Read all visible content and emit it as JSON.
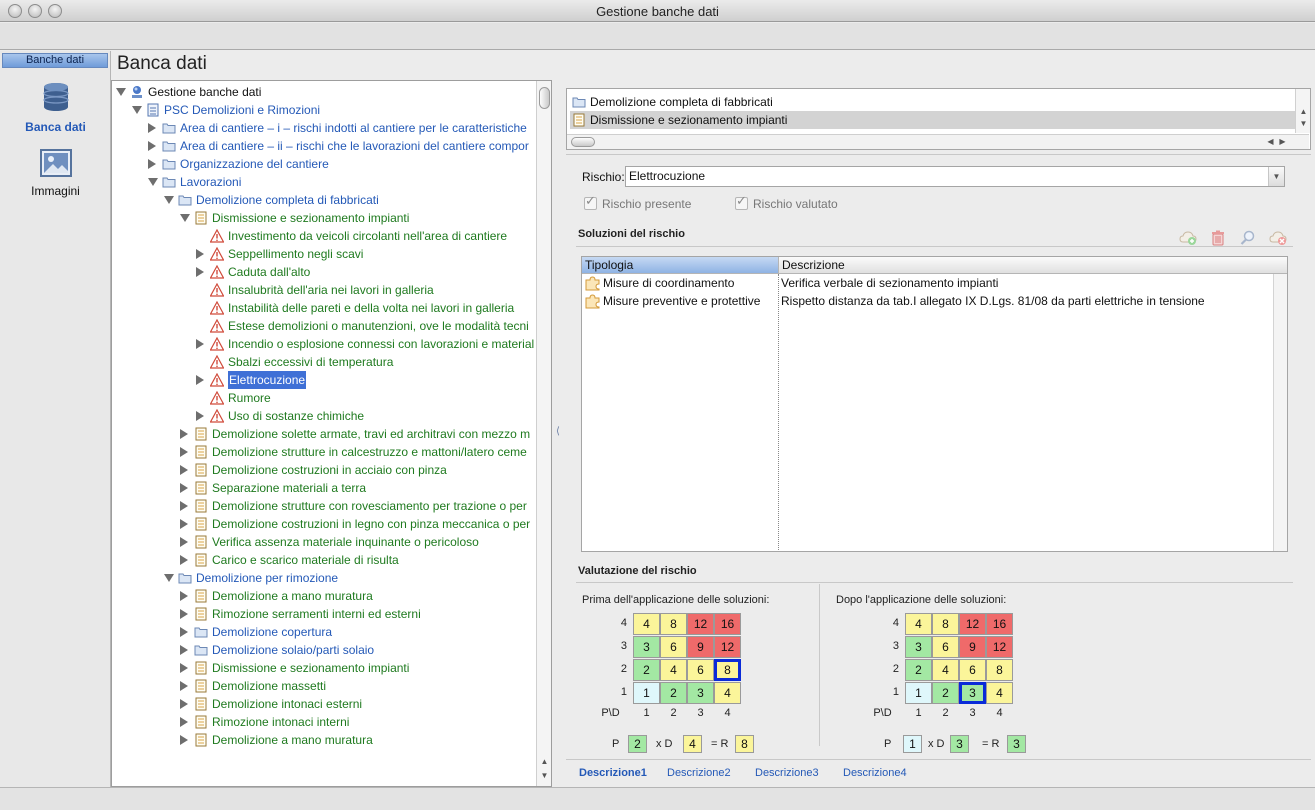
{
  "window": {
    "title": "Gestione banche dati"
  },
  "nav": {
    "header": "Banche dati",
    "items": [
      {
        "label": "Banca dati",
        "active": true,
        "icon": "database-icon"
      },
      {
        "label": "Immagini",
        "active": false,
        "icon": "image-icon"
      }
    ]
  },
  "page": {
    "title": "Banca dati"
  },
  "tree": {
    "rows": [
      {
        "label": "Gestione banche dati",
        "level": 0,
        "toggle": "open",
        "icon": "globe-icon",
        "color": "black"
      },
      {
        "label": "PSC Demolizioni e Rimozioni",
        "level": 1,
        "toggle": "open",
        "icon": "document-blue-icon",
        "color": "blue"
      },
      {
        "label": "Area di cantiere – i – rischi indotti al cantiere per le caratteristiche",
        "level": 2,
        "toggle": "closed",
        "icon": "folder-icon",
        "color": "blue"
      },
      {
        "label": "Area di cantiere – ii – rischi che le lavorazioni del cantiere compor",
        "level": 2,
        "toggle": "closed",
        "icon": "folder-icon",
        "color": "blue"
      },
      {
        "label": "Organizzazione del cantiere",
        "level": 2,
        "toggle": "closed",
        "icon": "folder-icon",
        "color": "blue"
      },
      {
        "label": "Lavorazioni",
        "level": 2,
        "toggle": "open",
        "icon": "folder-icon",
        "color": "blue"
      },
      {
        "label": "Demolizione completa di fabbricati",
        "level": 3,
        "toggle": "open",
        "icon": "folder-icon",
        "color": "blue"
      },
      {
        "label": "Dismissione e sezionamento impianti",
        "level": 4,
        "toggle": "open",
        "icon": "notepad-icon",
        "color": "green"
      },
      {
        "label": "Investimento da veicoli circolanti nell'area di cantiere",
        "level": 5,
        "toggle": "none",
        "icon": "warning-icon",
        "color": "green"
      },
      {
        "label": "Seppellimento negli scavi",
        "level": 5,
        "toggle": "closed",
        "icon": "warning-icon",
        "color": "green"
      },
      {
        "label": "Caduta dall'alto",
        "level": 5,
        "toggle": "closed",
        "icon": "warning-icon",
        "color": "green"
      },
      {
        "label": "Insalubrità dell'aria nei lavori in galleria",
        "level": 5,
        "toggle": "none",
        "icon": "warning-icon",
        "color": "green"
      },
      {
        "label": "Instabilità delle pareti e della volta nei lavori in galleria",
        "level": 5,
        "toggle": "none",
        "icon": "warning-icon",
        "color": "green"
      },
      {
        "label": "Estese demolizioni o manutenzioni, ove le modalità tecni",
        "level": 5,
        "toggle": "none",
        "icon": "warning-icon",
        "color": "green"
      },
      {
        "label": "Incendio o esplosione connessi con lavorazioni e material",
        "level": 5,
        "toggle": "closed",
        "icon": "warning-icon",
        "color": "green"
      },
      {
        "label": "Sbalzi eccessivi di temperatura",
        "level": 5,
        "toggle": "none",
        "icon": "warning-icon",
        "color": "green"
      },
      {
        "label": "Elettrocuzione",
        "level": 5,
        "toggle": "closed",
        "icon": "warning-icon",
        "color": "green",
        "selected": true
      },
      {
        "label": "Rumore",
        "level": 5,
        "toggle": "none",
        "icon": "warning-icon",
        "color": "green"
      },
      {
        "label": "Uso di sostanze chimiche",
        "level": 5,
        "toggle": "closed",
        "icon": "warning-icon",
        "color": "green"
      },
      {
        "label": "Demolizione solette armate, travi ed architravi con mezzo m",
        "level": 4,
        "toggle": "closed",
        "icon": "notepad-icon",
        "color": "green"
      },
      {
        "label": "Demolizione strutture in calcestruzzo e mattoni/latero ceme",
        "level": 4,
        "toggle": "closed",
        "icon": "notepad-icon",
        "color": "green"
      },
      {
        "label": "Demolizione costruzioni in acciaio con pinza",
        "level": 4,
        "toggle": "closed",
        "icon": "notepad-icon",
        "color": "green"
      },
      {
        "label": "Separazione materiali a terra",
        "level": 4,
        "toggle": "closed",
        "icon": "notepad-icon",
        "color": "green"
      },
      {
        "label": "Demolizione strutture con rovesciamento per trazione o per",
        "level": 4,
        "toggle": "closed",
        "icon": "notepad-icon",
        "color": "green"
      },
      {
        "label": "Demolizione costruzioni in legno con pinza meccanica o per",
        "level": 4,
        "toggle": "closed",
        "icon": "notepad-icon",
        "color": "green"
      },
      {
        "label": "Verifica assenza materiale inquinante o pericoloso",
        "level": 4,
        "toggle": "closed",
        "icon": "notepad-icon",
        "color": "green"
      },
      {
        "label": "Carico e scarico materiale di risulta",
        "level": 4,
        "toggle": "closed",
        "icon": "notepad-icon",
        "color": "green"
      },
      {
        "label": "Demolizione per rimozione",
        "level": 3,
        "toggle": "open",
        "icon": "folder-icon",
        "color": "blue"
      },
      {
        "label": "Demolizione a mano muratura",
        "level": 4,
        "toggle": "closed",
        "icon": "notepad-icon",
        "color": "green"
      },
      {
        "label": "Rimozione serramenti interni ed esterni",
        "level": 4,
        "toggle": "closed",
        "icon": "notepad-icon",
        "color": "green"
      },
      {
        "label": "Demolizione copertura",
        "level": 4,
        "toggle": "closed",
        "icon": "folder-icon",
        "color": "blue"
      },
      {
        "label": "Demolizione solaio/parti solaio",
        "level": 4,
        "toggle": "closed",
        "icon": "folder-icon",
        "color": "blue"
      },
      {
        "label": "Dismissione e sezionamento impianti",
        "level": 4,
        "toggle": "closed",
        "icon": "notepad-icon",
        "color": "green"
      },
      {
        "label": "Demolizione massetti",
        "level": 4,
        "toggle": "closed",
        "icon": "notepad-icon",
        "color": "green"
      },
      {
        "label": "Demolizione intonaci esterni",
        "level": 4,
        "toggle": "closed",
        "icon": "notepad-icon",
        "color": "green"
      },
      {
        "label": "Rimozione intonaci interni",
        "level": 4,
        "toggle": "closed",
        "icon": "notepad-icon",
        "color": "green"
      },
      {
        "label": "Demolizione a mano muratura",
        "level": 4,
        "toggle": "closed",
        "icon": "notepad-icon",
        "color": "green"
      }
    ]
  },
  "breadcrumb_list": {
    "rows": [
      {
        "label": "Demolizione completa di fabbricati",
        "icon": "folder-icon",
        "selected": false
      },
      {
        "label": "Dismissione e sezionamento impianti",
        "icon": "notepad-icon",
        "selected": true
      }
    ]
  },
  "rischio": {
    "label": "Rischio:",
    "value": "Elettrocuzione",
    "presente_label": "Rischio presente",
    "valutato_label": "Rischio valutato"
  },
  "soluzioni": {
    "title": "Soluzioni del rischio",
    "columns": [
      "Tipologia",
      "Descrizione"
    ],
    "rows": [
      {
        "tipologia": "Misure di coordinamento",
        "descrizione": "Verifica verbale di sezionamento impianti"
      },
      {
        "tipologia": "Misure preventive e protettive",
        "descrizione": "Rispetto distanza da tab.I allegato IX D.Lgs. 81/08 da parti elettriche in tensione"
      }
    ]
  },
  "valutazione": {
    "title": "Valutazione del rischio",
    "axis_corner": "P\\D",
    "axis_labels": [
      "1",
      "2",
      "3",
      "4"
    ],
    "matrix": [
      [
        1,
        2,
        3,
        4
      ],
      [
        2,
        4,
        6,
        8
      ],
      [
        3,
        6,
        9,
        12
      ],
      [
        4,
        8,
        12,
        16
      ]
    ],
    "colors": {
      "cyan": "#dff7fb",
      "green": "#a3e8a3",
      "yellow": "#fbf59a",
      "red": "#ef6a6a"
    },
    "prima": {
      "title": "Prima dell'applicazione delle soluzioni:",
      "highlight": {
        "p": 2,
        "d": 4
      },
      "p_label": "P",
      "p_value": "2",
      "d_label": "x D",
      "d_value": "4",
      "r_label": "= R",
      "r_value": "8"
    },
    "dopo": {
      "title": "Dopo l'applicazione delle soluzioni:",
      "highlight": {
        "p": 1,
        "d": 3
      },
      "p_label": "P",
      "p_value": "1",
      "d_label": "x D",
      "d_value": "3",
      "r_label": "= R",
      "r_value": "3"
    }
  },
  "tabs": [
    {
      "label": "Descrizione1",
      "active": true
    },
    {
      "label": "Descrizione2",
      "active": false
    },
    {
      "label": "Descrizione3",
      "active": false
    },
    {
      "label": "Descrizione4",
      "active": false
    }
  ]
}
